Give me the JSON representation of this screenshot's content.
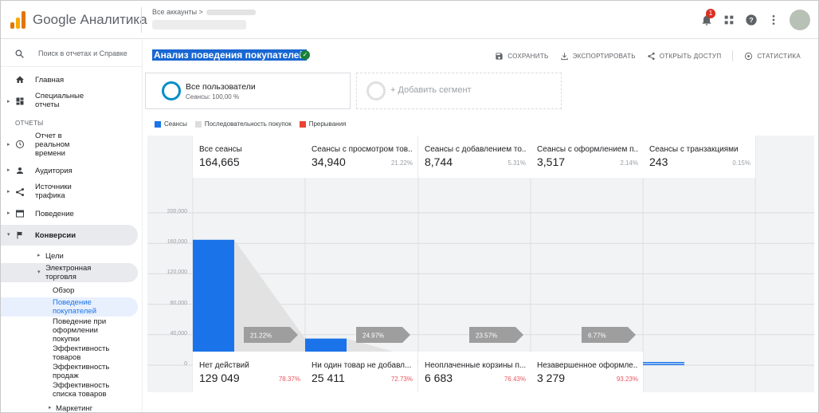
{
  "header": {
    "app_title": "Google Аналитика",
    "breadcrumb": "Все аккаунты >",
    "notification_count": "1"
  },
  "sidebar": {
    "search_placeholder": "Поиск в отчетах и Справке",
    "items": [
      {
        "label": "Главная",
        "icon": "home-icon"
      },
      {
        "label": "Специальные отчеты",
        "icon": "dashboard-icon"
      },
      {
        "label": "Отчет в реальном времени",
        "icon": "clock-icon"
      },
      {
        "label": "Аудитория",
        "icon": "person-icon"
      },
      {
        "label": "Источники трафика",
        "icon": "acquisition-icon"
      },
      {
        "label": "Поведение",
        "icon": "behavior-icon"
      },
      {
        "label": "Конверсии",
        "icon": "flag-icon"
      }
    ],
    "section_label": "ОТЧЕТЫ",
    "conversions_children": {
      "goals": "Цели",
      "ecommerce": "Электронная торговля",
      "ecommerce_items": [
        "Обзор",
        "Поведение покупателей",
        "Поведение при оформлении покупки",
        "Эффективность товаров",
        "Эффективность продаж",
        "Эффективность списка товаров"
      ],
      "marketing": "Маркетинг"
    }
  },
  "main": {
    "page_title": "Анализ поведения покупателей",
    "actions": {
      "save": "СОХРАНИТЬ",
      "export": "ЭКСПОРТИРОВАТЬ",
      "share": "ОТКРЫТЬ ДОСТУП",
      "insights": "СТАТИСТИКА"
    },
    "segment": {
      "name": "Все пользователи",
      "sub": "Сеансы: 100,00 %",
      "add_label": "+ Добавить сегмент"
    },
    "legend": [
      {
        "label": "Сеансы",
        "color": "#1a73e8"
      },
      {
        "label": "Последовательность покупок",
        "color": "#dddddd"
      },
      {
        "label": "Прерывания",
        "color": "#ea4335"
      }
    ]
  },
  "chart_data": {
    "type": "bar",
    "y_ticks": [
      "200,000",
      "160,000",
      "120,000",
      "80,000",
      "40,000",
      "0"
    ],
    "ylim": [
      0,
      200000
    ],
    "stages": [
      {
        "label": "Все сеансы",
        "value_text": "164,665",
        "pct": "",
        "value": 164665
      },
      {
        "label": "Сеансы с просмотром тов...",
        "value_text": "34,940",
        "pct": "21.22%",
        "value": 34940
      },
      {
        "label": "Сеансы с добавлением то...",
        "value_text": "8,744",
        "pct": "5.31%",
        "value": 8744
      },
      {
        "label": "Сеансы с оформлением п...",
        "value_text": "3,517",
        "pct": "2.14%",
        "value": 3517
      },
      {
        "label": "Сеансы с транзакциями",
        "value_text": "243",
        "pct": "0.15%",
        "value": 243
      }
    ],
    "transitions": [
      "21.22%",
      "24.97%",
      "23.57%",
      "6.77%"
    ],
    "abandonments": [
      {
        "label": "Нет действий",
        "value_text": "129 049",
        "pct": "78.37%"
      },
      {
        "label": "Ни один товар не добавл...",
        "value_text": "25 411",
        "pct": "72.73%"
      },
      {
        "label": "Неоплаченные корзины п...",
        "value_text": "6 683",
        "pct": "76.43%"
      },
      {
        "label": "Незавершенное оформле...",
        "value_text": "3 279",
        "pct": "93.23%"
      }
    ],
    "colors": {
      "bar": "#1a73e8",
      "flow": "#e2e2e2",
      "arrow": "#ea4335",
      "transition_tag": "#9e9e9e",
      "annotation": "#e53935"
    }
  }
}
